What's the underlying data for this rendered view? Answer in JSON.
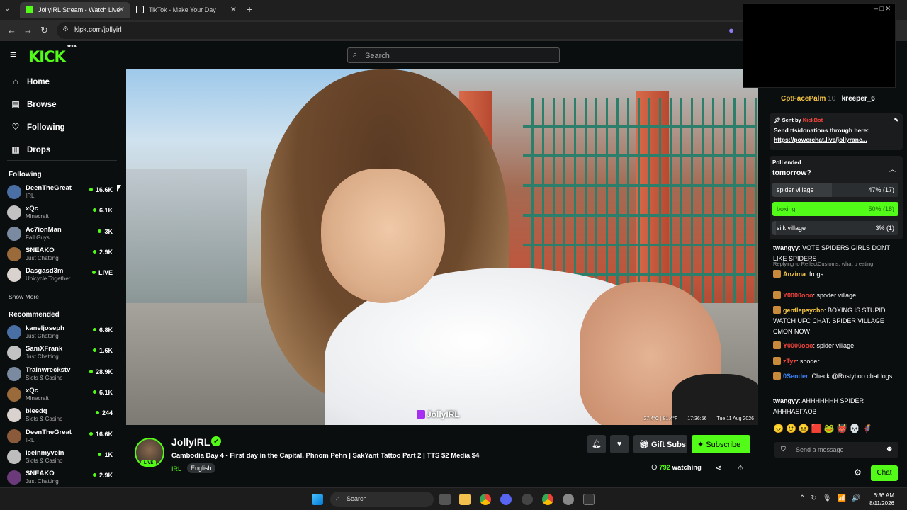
{
  "browser": {
    "tabs": [
      {
        "label": "JollyIRL Stream - Watch Live",
        "favicon_color": "#53fc18",
        "active": true
      },
      {
        "label": "TikTok - Make Your Day",
        "favicon_color": "#ffffff",
        "active": false
      }
    ],
    "url": "kick.com/jollyirl"
  },
  "header": {
    "logo": "KICK",
    "logo_tag": "BETA",
    "search_placeholder": "Search"
  },
  "sidebar": {
    "nav": [
      {
        "label": "Home",
        "icon": "home-icon"
      },
      {
        "label": "Browse",
        "icon": "browse-icon"
      },
      {
        "label": "Following",
        "icon": "heart-icon"
      },
      {
        "label": "Drops",
        "icon": "drops-icon"
      }
    ],
    "following_heading": "Following",
    "following": [
      {
        "name": "DeenTheGreat",
        "category": "IRL",
        "viewers": "16.6K"
      },
      {
        "name": "xQc",
        "category": "Minecraft",
        "viewers": "6.1K"
      },
      {
        "name": "Ac7ionMan",
        "category": "Fall Guys",
        "viewers": "3K"
      },
      {
        "name": "SNEAKO",
        "category": "Just Chatting",
        "viewers": "2.9K"
      },
      {
        "name": "Dasgasd3m",
        "category": "Unicycle Together",
        "viewers": "LIVE"
      }
    ],
    "show_more": "Show More",
    "recommended_heading": "Recommended",
    "recommended": [
      {
        "name": "kaneljoseph",
        "category": "Just Chatting",
        "viewers": "6.8K"
      },
      {
        "name": "SamXFrank",
        "category": "Just Chatting",
        "viewers": "1.6K"
      },
      {
        "name": "Trainwreckstv",
        "category": "Slots & Casino",
        "viewers": "28.9K"
      },
      {
        "name": "xQc",
        "category": "Minecraft",
        "viewers": "6.1K"
      },
      {
        "name": "bleedq",
        "category": "Slots & Casino",
        "viewers": "244"
      },
      {
        "name": "DeenTheGreat",
        "category": "IRL",
        "viewers": "16.6K"
      },
      {
        "name": "iceinmyvein",
        "category": "Slots & Casino",
        "viewers": "1K"
      },
      {
        "name": "SNEAKO",
        "category": "Just Chatting",
        "viewers": "2.9K"
      }
    ]
  },
  "video": {
    "watermark": "JollyIRL",
    "temperature": "27.4°C | 81.4°F",
    "time": "17:36:56",
    "date": "Tue 11 Aug 2026"
  },
  "stream": {
    "streamer": "JollyIRL",
    "live_label": "LIVE",
    "title": "Cambodia Day 4 - First day in the Capital, Phnom Pehn | SakYant Tattoo Part 2 | TTS $2 Media $4",
    "category": "IRL",
    "language": "English",
    "gift_label": "Gift Subs",
    "subscribe_label": "Subscribe",
    "viewers": "792",
    "watching_label": "watching"
  },
  "chat": {
    "top_gifters": [
      "CptFacePalm",
      "10",
      "kreeper_6"
    ],
    "pinned": {
      "sent_by": "Sent by",
      "sender": "KickBot",
      "text": "Send tts/donations through here:",
      "link": "https://powerchat.live/jollyranc..."
    },
    "poll": {
      "status": "Poll ended",
      "question": "tomorrow?",
      "options": [
        {
          "label": "spider village",
          "result": "47% (17)",
          "fraction": 0.47,
          "winner": false
        },
        {
          "label": "boxing",
          "result": "50% (18)",
          "fraction": 0.5,
          "winner": true
        },
        {
          "label": "silk village",
          "result": "3% (1)",
          "fraction": 0.03,
          "winner": false
        }
      ]
    },
    "messages": [
      {
        "user": "twangyy",
        "color": "#ffffff",
        "text": "VOTE SPIDERS GIRLS DONT LIKE SPIDERS",
        "reply": ""
      },
      {
        "user": "Anzima",
        "color": "#f7c744",
        "text": "frogs",
        "reply": "Replying to ReflectCustoms: what u eating"
      },
      {
        "user": "Y0000ooo",
        "color": "#f5443b",
        "text": "spoder village",
        "reply": ""
      },
      {
        "user": "gentlepsycho",
        "color": "#f7c744",
        "text": "BOXING IS STUPID WATCH UFC CHAT. SPIDER VILLAGE CMON NOW",
        "reply": ""
      },
      {
        "user": "Y0000ooo",
        "color": "#f5443b",
        "text": "spider village",
        "reply": ""
      },
      {
        "user": "zTyz",
        "color": "#f5443b",
        "text": "spoder",
        "reply": ""
      },
      {
        "user": "0Sender",
        "color": "#3b82f6",
        "text": "Check @Rustyboo chat logs",
        "reply": ""
      },
      {
        "user": "twangyy",
        "color": "#ffffff",
        "text": "AHHHHHHH SPIDER AHHHASFAOB",
        "reply": ""
      }
    ],
    "input_placeholder": "Send a message",
    "chat_button": "Chat"
  },
  "taskbar": {
    "search_label": "Search",
    "time": "6:36 AM",
    "date": "8/11/2026"
  },
  "colors": {
    "kick_green": "#53fc18",
    "background": "#0b0e0f"
  }
}
